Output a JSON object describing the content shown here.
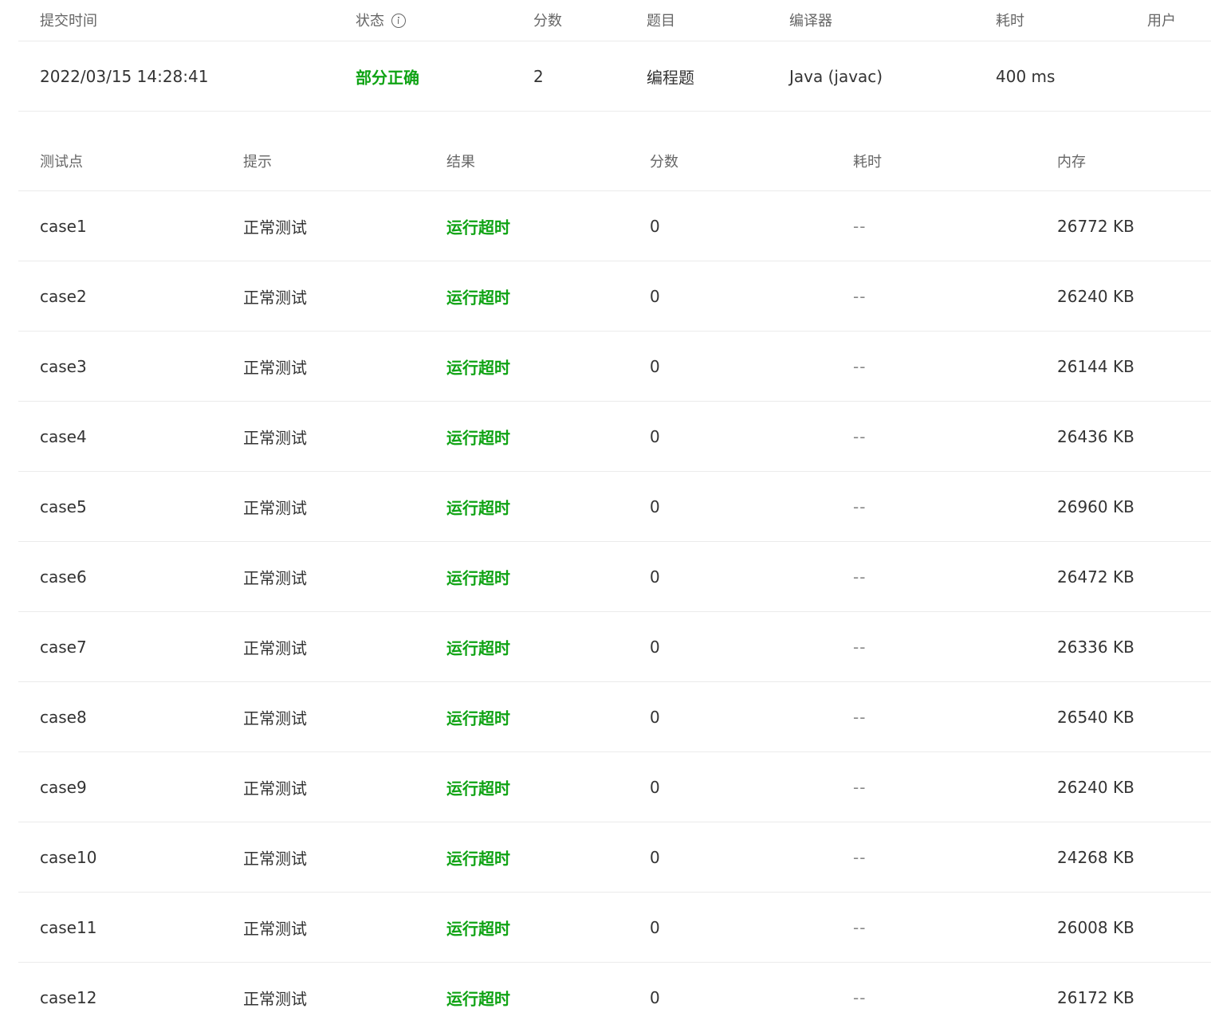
{
  "submission": {
    "headers": {
      "time": "提交时间",
      "status": "状态",
      "score": "分数",
      "problem": "题目",
      "compiler": "编译器",
      "duration": "耗时",
      "user": "用户"
    },
    "row": {
      "time": "2022/03/15 14:28:41",
      "status": "部分正确",
      "score": "2",
      "problem": "编程题",
      "compiler": "Java (javac)",
      "duration": "400 ms"
    },
    "status_icon": "info-icon"
  },
  "cases": {
    "headers": {
      "case": "测试点",
      "hint": "提示",
      "result": "结果",
      "score": "分数",
      "time": "耗时",
      "memory": "内存"
    },
    "rows": [
      {
        "case": "case1",
        "hint": "正常测试",
        "result": "运行超时",
        "score": "0",
        "time": "--",
        "memory": "26772 KB"
      },
      {
        "case": "case2",
        "hint": "正常测试",
        "result": "运行超时",
        "score": "0",
        "time": "--",
        "memory": "26240 KB"
      },
      {
        "case": "case3",
        "hint": "正常测试",
        "result": "运行超时",
        "score": "0",
        "time": "--",
        "memory": "26144 KB"
      },
      {
        "case": "case4",
        "hint": "正常测试",
        "result": "运行超时",
        "score": "0",
        "time": "--",
        "memory": "26436 KB"
      },
      {
        "case": "case5",
        "hint": "正常测试",
        "result": "运行超时",
        "score": "0",
        "time": "--",
        "memory": "26960 KB"
      },
      {
        "case": "case6",
        "hint": "正常测试",
        "result": "运行超时",
        "score": "0",
        "time": "--",
        "memory": "26472 KB"
      },
      {
        "case": "case7",
        "hint": "正常测试",
        "result": "运行超时",
        "score": "0",
        "time": "--",
        "memory": "26336 KB"
      },
      {
        "case": "case8",
        "hint": "正常测试",
        "result": "运行超时",
        "score": "0",
        "time": "--",
        "memory": "26540 KB"
      },
      {
        "case": "case9",
        "hint": "正常测试",
        "result": "运行超时",
        "score": "0",
        "time": "--",
        "memory": "26240 KB"
      },
      {
        "case": "case10",
        "hint": "正常测试",
        "result": "运行超时",
        "score": "0",
        "time": "--",
        "memory": "24268 KB"
      },
      {
        "case": "case11",
        "hint": "正常测试",
        "result": "运行超时",
        "score": "0",
        "time": "--",
        "memory": "26008 KB"
      },
      {
        "case": "case12",
        "hint": "正常测试",
        "result": "运行超时",
        "score": "0",
        "time": "--",
        "memory": "26172 KB"
      }
    ]
  },
  "colors": {
    "accent_green": "#0fa314",
    "header_text": "#666666",
    "body_text": "#333333",
    "divider": "#ebebeb"
  }
}
